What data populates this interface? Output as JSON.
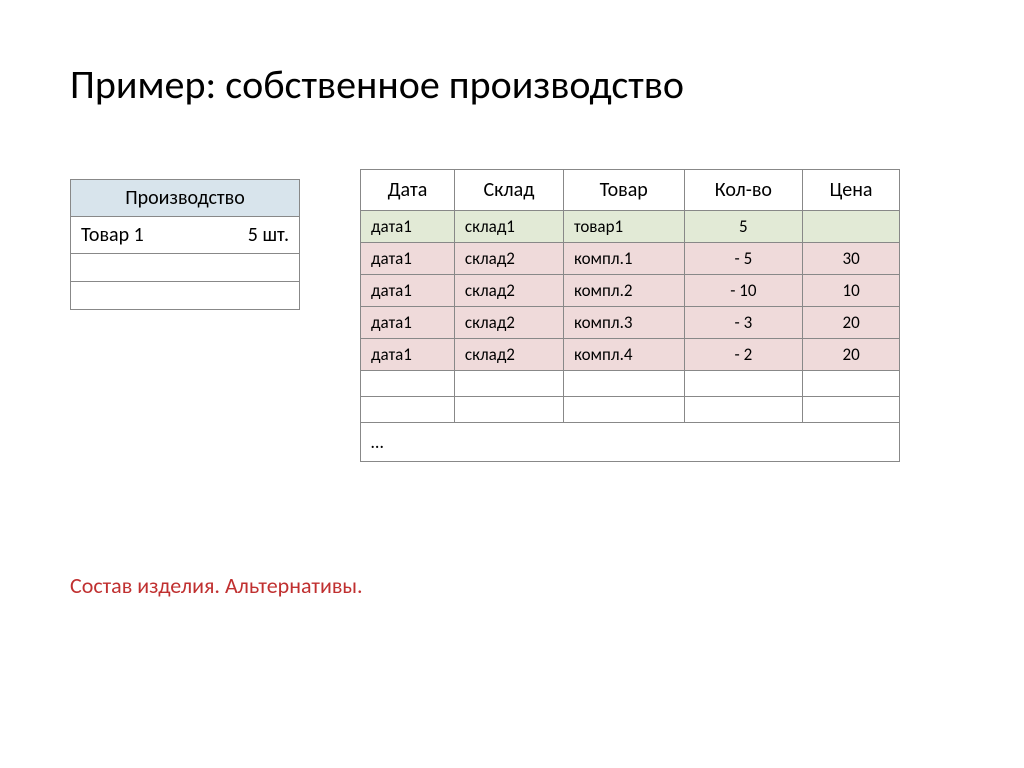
{
  "title": "Пример: собственное производство",
  "small_table": {
    "header": "Производство",
    "row1_item": "Товар 1",
    "row1_qty": "5 шт."
  },
  "big_table": {
    "headers": [
      "Дата",
      "Склад",
      "Товар",
      "Кол-во",
      "Цена"
    ],
    "rows": [
      {
        "date": "дата1",
        "warehouse": "склад1",
        "product": "товар1",
        "qty": "5",
        "price": "",
        "cls": "green"
      },
      {
        "date": "дата1",
        "warehouse": "склад2",
        "product": "компл.1",
        "qty": "- 5",
        "price": "30",
        "cls": "pink"
      },
      {
        "date": "дата1",
        "warehouse": "склад2",
        "product": "компл.2",
        "qty": "- 10",
        "price": "10",
        "cls": "pink"
      },
      {
        "date": "дата1",
        "warehouse": "склад2",
        "product": "компл.3",
        "qty": "- 3",
        "price": "20",
        "cls": "pink"
      },
      {
        "date": "дата1",
        "warehouse": "склад2",
        "product": "компл.4",
        "qty": "- 2",
        "price": "20",
        "cls": "pink"
      }
    ],
    "ellipsis": "…"
  },
  "footer_note": "Состав изделия. Альтернативы."
}
